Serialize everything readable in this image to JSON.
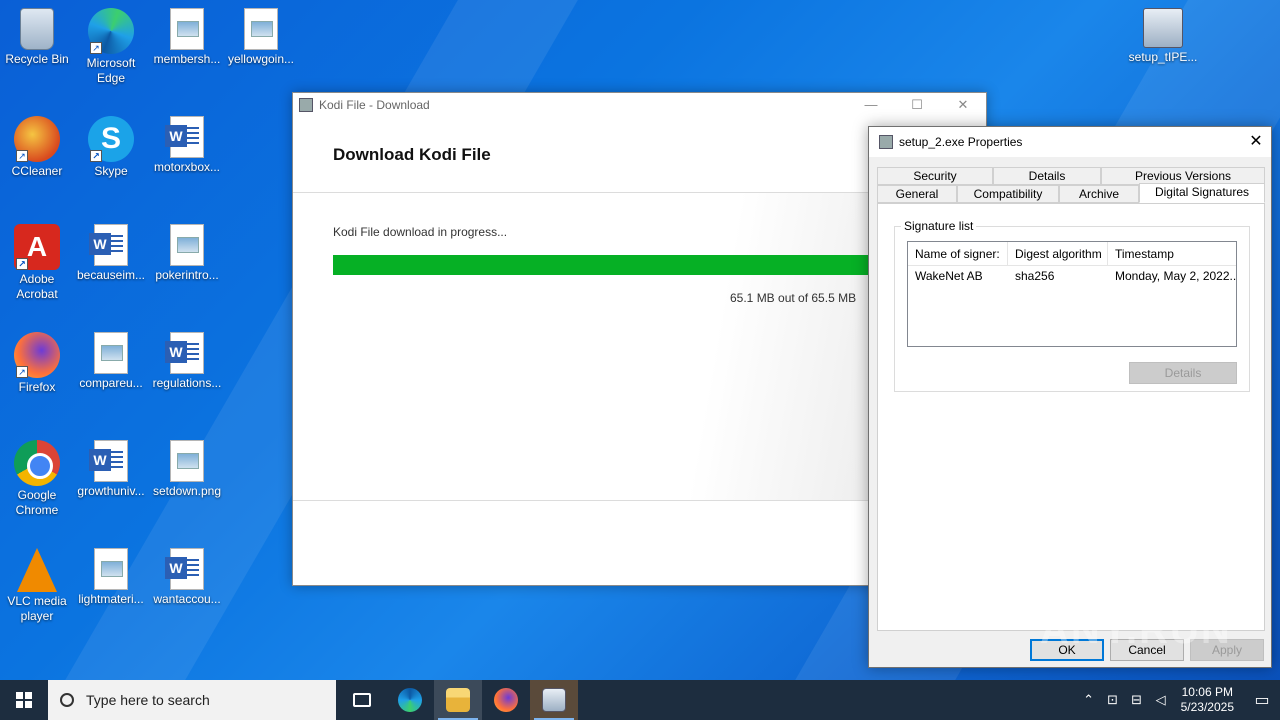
{
  "desktop": {
    "icons": [
      {
        "label": "Recycle Bin"
      },
      {
        "label": "Microsoft Edge"
      },
      {
        "label": "membersh..."
      },
      {
        "label": "yellowgoin..."
      },
      {
        "label": "CCleaner"
      },
      {
        "label": "Skype"
      },
      {
        "label": "motorxbox..."
      },
      {
        "label": "Adobe Acrobat"
      },
      {
        "label": "becauseim..."
      },
      {
        "label": "pokerintro..."
      },
      {
        "label": "Firefox"
      },
      {
        "label": "compareu..."
      },
      {
        "label": "regulations..."
      },
      {
        "label": "Google Chrome"
      },
      {
        "label": "growthuniv..."
      },
      {
        "label": "setdown.png"
      },
      {
        "label": "VLC media player"
      },
      {
        "label": "lightmateri..."
      },
      {
        "label": "wantaccou..."
      },
      {
        "label": "setup_tIPE..."
      }
    ],
    "watermark": "ANY.RUN"
  },
  "kodi_window": {
    "title": "Kodi File - Download",
    "heading": "Download Kodi File",
    "status": "Kodi File download in progress...",
    "progress_fraction": 0.994,
    "size_text": "65.1 MB out of 65.5 MB",
    "btn_min": "—",
    "btn_max": "☐",
    "btn_close": "✕"
  },
  "properties_dialog": {
    "title": "setup_2.exe Properties",
    "close": "✕",
    "tabs_row1": [
      "Security",
      "Details",
      "Previous Versions"
    ],
    "tabs_row2": [
      "General",
      "Compatibility",
      "Archive",
      "Digital Signatures"
    ],
    "active_tab": "Digital Signatures",
    "group_label": "Signature list",
    "columns": [
      "Name of signer:",
      "Digest algorithm",
      "Timestamp"
    ],
    "rows": [
      {
        "signer": "WakeNet AB",
        "digest": "sha256",
        "timestamp": "Monday, May 2, 2022..."
      }
    ],
    "details_button": "Details",
    "ok_button": "OK",
    "cancel_button": "Cancel",
    "apply_button": "Apply"
  },
  "taskbar": {
    "search_placeholder": "Type here to search",
    "time": "10:06 PM",
    "date": "5/23/2025"
  },
  "colors": {
    "progress": "#06b025",
    "desktop": "#0b74e0",
    "taskbar": "#1d2d3f"
  }
}
